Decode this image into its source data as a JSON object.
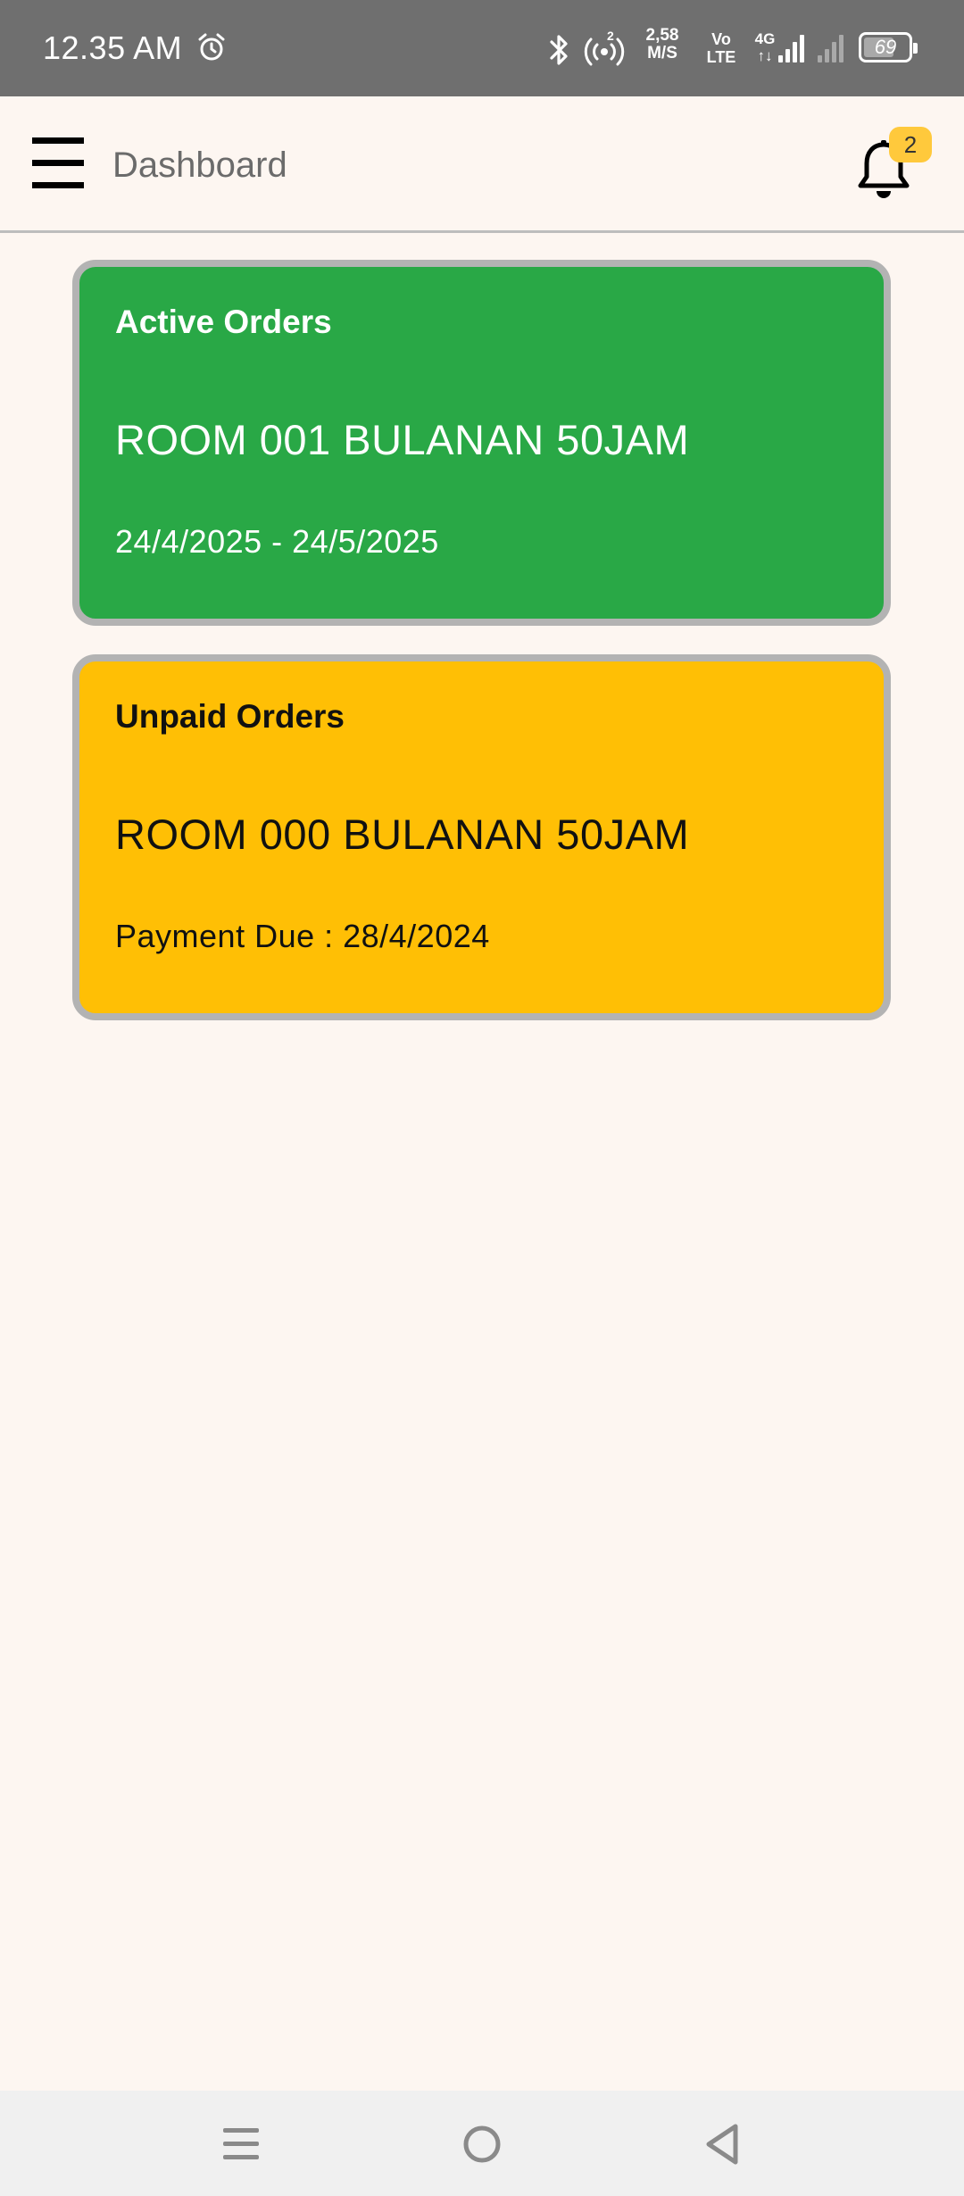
{
  "status_bar": {
    "time": "12.35 AM",
    "alarm_icon": "alarm-icon",
    "bluetooth_icon": "bluetooth-icon",
    "hotspot_icon": "hotspot-icon",
    "hotspot_count": "2",
    "net_speed_value": "2,58",
    "net_speed_unit": "M/S",
    "volte_top": "Vo",
    "volte_bottom": "LTE",
    "network_type": "4G",
    "network_arrows": "↑↓",
    "battery_level": "69",
    "battery_percent": 69
  },
  "app_bar": {
    "menu_icon": "hamburger-menu-icon",
    "title": "Dashboard",
    "notification_icon": "bell-icon",
    "notification_count": "2"
  },
  "orders": {
    "active": {
      "heading": "Active Orders",
      "room": "ROOM 001 BULANAN 50JAM",
      "period": "24/4/2025 - 24/5/2025"
    },
    "unpaid": {
      "heading": "Unpaid Orders",
      "room": "ROOM 000 BULANAN 50JAM",
      "due": "Payment Due : 28/4/2024"
    }
  },
  "colors": {
    "background": "#fdf6f1",
    "status_bar": "#6f6f6f",
    "active_card": "#29a846",
    "unpaid_card": "#ffbf05",
    "card_border": "#b3b3b3",
    "badge": "#ffc93c",
    "nav_bar": "#f0f0f0"
  },
  "nav_bar": {
    "recents_icon": "recents-icon",
    "home_icon": "home-icon",
    "back_icon": "back-icon"
  }
}
